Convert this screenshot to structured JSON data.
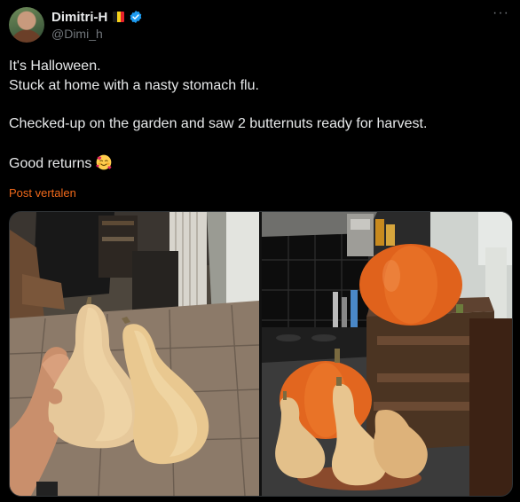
{
  "author": {
    "display_name": "Dimitri-H",
    "handle": "@Dimi_h",
    "flag_colors": [
      "#1a1a1a",
      "#f6d21b",
      "#e8222b"
    ],
    "verified_color": "#1d9bf0"
  },
  "tweet": {
    "lines": [
      "It's Halloween.",
      "Stuck at home with a nasty stomach flu.",
      "",
      "Checked-up on the garden and saw 2 butternuts ready for harvest.",
      "",
      "Good returns"
    ],
    "emoji": "smiling-face-with-hearts",
    "translate_label": "Post vertalen"
  },
  "menu": {
    "more_label": "···"
  },
  "media": {
    "images": [
      {
        "name": "hand-holding-two-butternuts"
      },
      {
        "name": "pumpkins-and-butternuts-in-kitchen"
      }
    ]
  },
  "colors": {
    "background": "#000000",
    "text": "#e7e9ea",
    "muted": "#71767b",
    "translate_link": "#f26a1b"
  }
}
